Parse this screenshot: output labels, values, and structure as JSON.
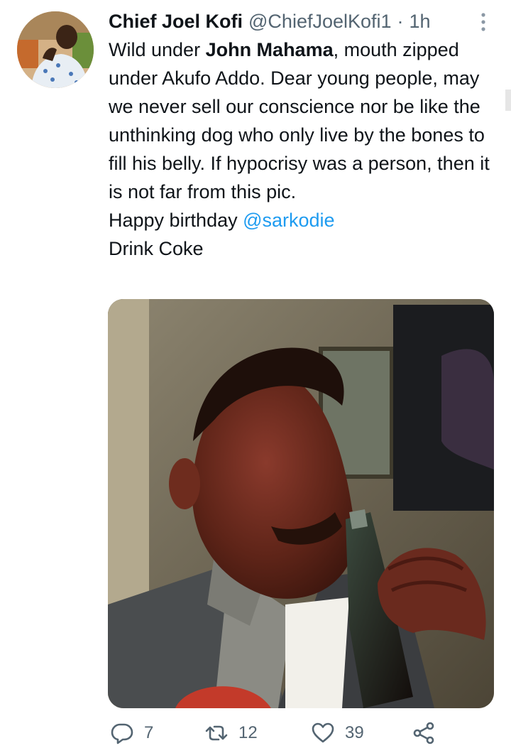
{
  "tweet": {
    "author_name": "Chief Joel Kofi",
    "handle": "@ChiefJoelKofi1",
    "separator": "·",
    "time": "1h",
    "body": {
      "line1_pre": "Wild under ",
      "line1_bold_1": "John Mahama",
      "line1_post": ", mouth zipped under Akufo Addo. Dear young people, may we never sell our conscience nor be like the unthinking dog who only live by the bones to fill his belly. If hypocrisy was a person, then it is not far from this pic.",
      "line2_pre": "Happy birthday ",
      "mention": "@sarkodie",
      "line3": "Drink Coke"
    }
  },
  "actions": {
    "reply_count": "7",
    "retweet_count": "12",
    "like_count": "39"
  },
  "icons": {
    "more": "more-vertical-icon",
    "reply": "reply-icon",
    "retweet": "retweet-icon",
    "like": "heart-icon",
    "share": "share-icon"
  },
  "colors": {
    "text_primary": "#0f1419",
    "text_secondary": "#536471",
    "mention": "#1d9bf0"
  }
}
